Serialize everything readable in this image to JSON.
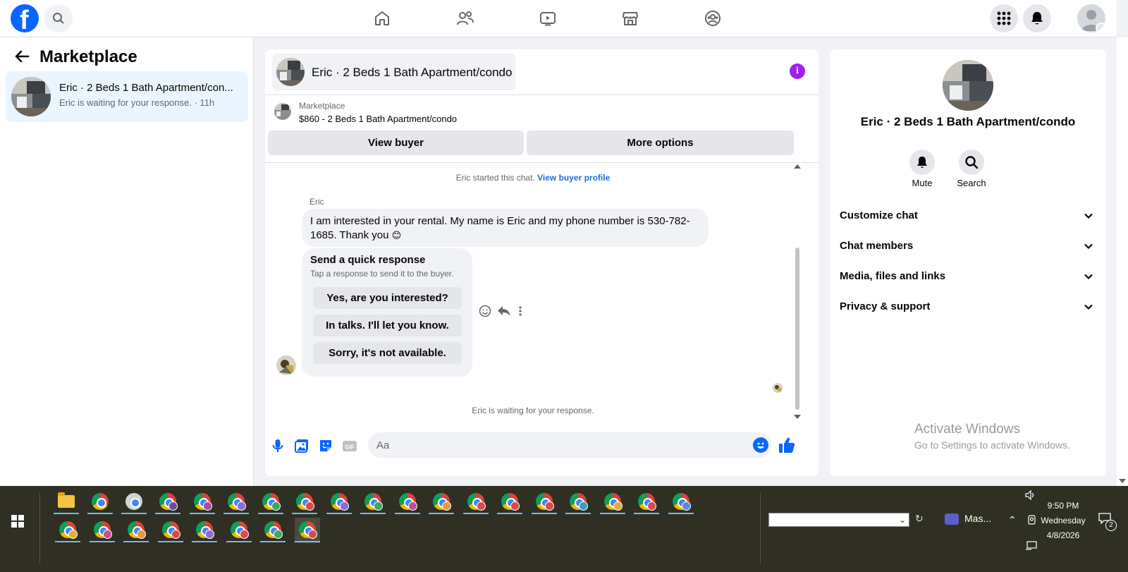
{
  "topnav": {
    "logo_letter": "f",
    "icons": [
      "home-icon",
      "friends-icon",
      "video-icon",
      "marketplace-icon",
      "groups-icon",
      "menu-grid-icon",
      "notifications-icon",
      "account-icon"
    ]
  },
  "left_panel": {
    "title": "Marketplace",
    "conversation": {
      "title": "Eric · 2 Beds 1 Bath Apartment/con...",
      "subtitle": "Eric is waiting for your response. · 11h"
    }
  },
  "chat": {
    "header_title": "Eric · 2 Beds 1 Bath Apartment/condo",
    "marketplace_label": "Marketplace",
    "listing": "$860 - 2 Beds 1 Bath Apartment/condo",
    "view_buyer": "View buyer",
    "more_options": "More options",
    "started_text": "Eric started this chat.",
    "view_buyer_profile": "View buyer profile",
    "sender_name": "Eric",
    "message": "I am interested in your rental. My name is Eric and my phone number is 530-782-1685. Thank you ",
    "message_glyph": "😊",
    "quick_response": {
      "title": "Send a quick response",
      "subtitle": "Tap a response to send it to the buyer.",
      "options": [
        "Yes, are you interested?",
        "In talks. I'll let you know.",
        "Sorry, it's not available."
      ]
    },
    "waiting_text": "Eric is waiting for your response.",
    "composer_placeholder": "Aa"
  },
  "right_panel": {
    "title": "Eric · 2 Beds 1 Bath Apartment/condo",
    "mute": "Mute",
    "search": "Search",
    "sections": [
      "Customize chat",
      "Chat members",
      "Media, files and links",
      "Privacy & support"
    ]
  },
  "watermark": {
    "line1": "Activate Windows",
    "line2": "Go to Settings to activate Windows."
  },
  "taskbar": {
    "app_label": "Mas...",
    "time": "9:50 PM",
    "day": "Wednesday",
    "date": "4/8/2026",
    "notification_count": "2",
    "badge_colors": [
      "#6a4c9c",
      "#b048a8",
      "#8a6cd6",
      "#3da85a",
      "#d94a4a",
      "#8a6cd6",
      "#3da85a",
      "#c05090",
      "#e39a3a",
      "#d94a4a",
      "#d94a4a",
      "#d94a4a",
      "#3aa0b8",
      "#e0b030",
      "#d94a4a",
      "#5a8ae0"
    ],
    "row2_badge_colors": [
      "#e0b030",
      "#c05090",
      "#e39a3a",
      "#d94a4a",
      "#8a6cd6",
      "#d94a4a",
      "#3da85a",
      "#d94a4a"
    ]
  }
}
